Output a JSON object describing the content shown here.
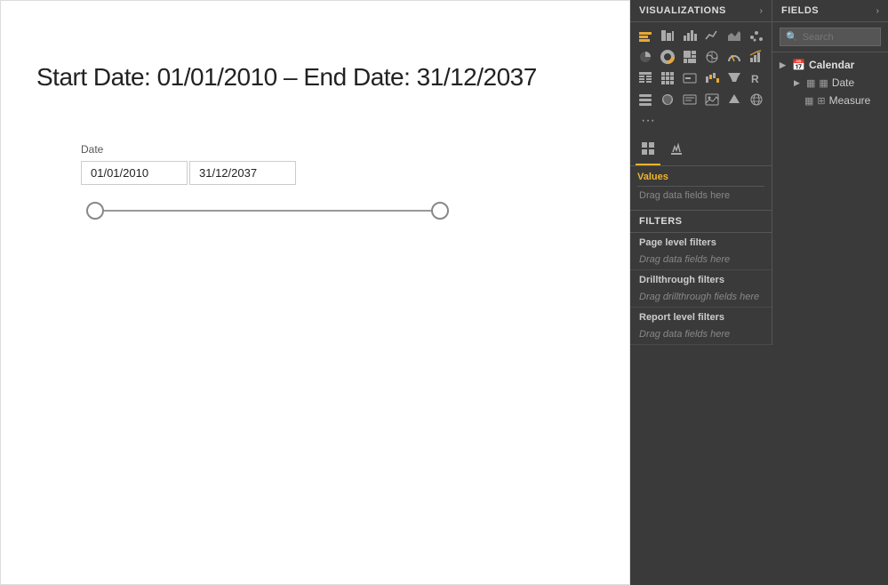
{
  "report": {
    "title": "Start Date: 01/01/2010 – End Date: 31/12/2037",
    "date_label": "Date",
    "start_date": "01/01/2010",
    "end_date": "31/12/2037"
  },
  "visualizations_panel": {
    "title": "VISUALIZATIONS",
    "chevron": "›"
  },
  "fields_panel": {
    "title": "FIELDS",
    "chevron": "›",
    "search_placeholder": "Search"
  },
  "fields_tree": {
    "calendar_item": {
      "label": "Calendar",
      "date_child": "Date",
      "measure_child": "Measure"
    }
  },
  "viz_tabs": {
    "fields_tab_icon": "⊞",
    "format_tab_icon": "🎨"
  },
  "values_section": {
    "label": "Values",
    "drop_hint": "Drag data fields here"
  },
  "filters": {
    "title": "FILTERS",
    "page_level_label": "Page level filters",
    "page_drop_hint": "Drag data fields here",
    "drillthrough_label": "Drillthrough filters",
    "drillthrough_drop_hint": "Drag drillthrough fields here",
    "report_level_label": "Report level filters",
    "report_drop_hint": "Drag data fields here"
  }
}
